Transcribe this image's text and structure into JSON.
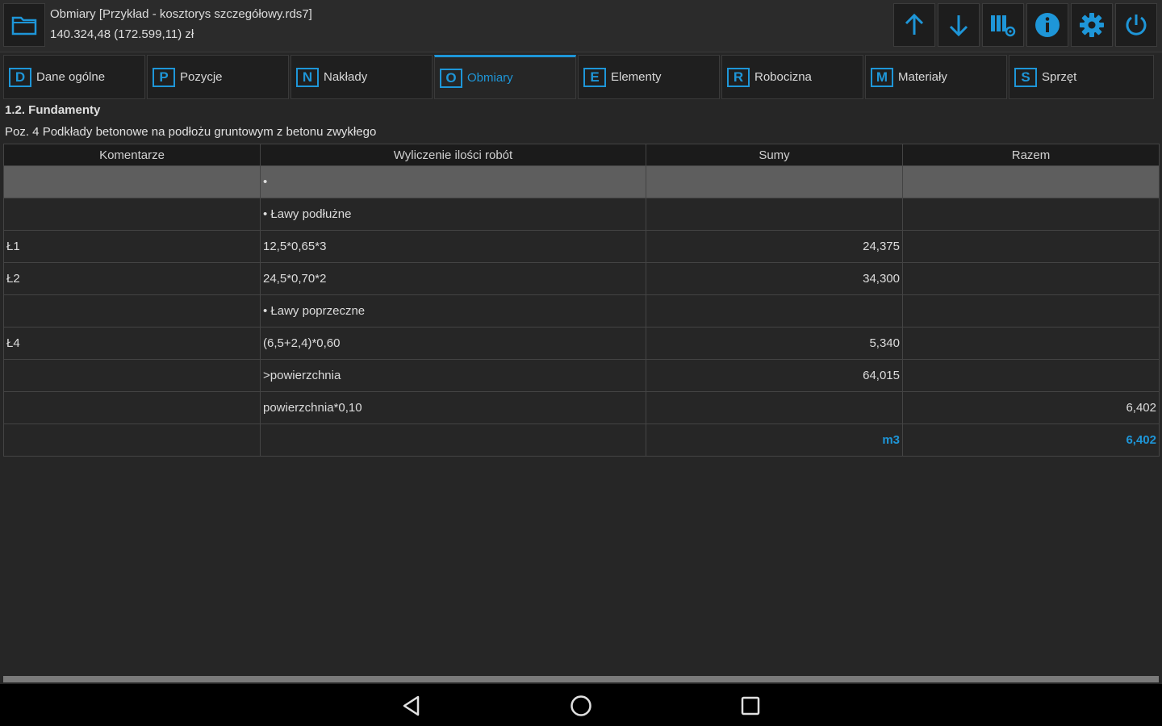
{
  "header": {
    "title": "Obmiary [Przykład - kosztorys szczegółowy.rds7]",
    "subtitle": "140.324,48 (172.599,11) zł",
    "toolbar": [
      {
        "icon": "arrow-up-icon"
      },
      {
        "icon": "arrow-down-icon"
      },
      {
        "icon": "columns-settings-icon"
      },
      {
        "icon": "info-icon"
      },
      {
        "icon": "gear-icon"
      },
      {
        "icon": "power-icon"
      }
    ]
  },
  "tabs": [
    {
      "key": "D",
      "label": "Dane ogólne",
      "active": false
    },
    {
      "key": "P",
      "label": "Pozycje",
      "active": false
    },
    {
      "key": "N",
      "label": "Nakłady",
      "active": false
    },
    {
      "key": "O",
      "label": "Obmiary",
      "active": true
    },
    {
      "key": "E",
      "label": "Elementy",
      "active": false
    },
    {
      "key": "R",
      "label": "Robocizna",
      "active": false
    },
    {
      "key": "M",
      "label": "Materiały",
      "active": false
    },
    {
      "key": "S",
      "label": "Sprzęt",
      "active": false
    }
  ],
  "breadcrumb": {
    "section": "1.2. Fundamenty",
    "position": "Poz. 4 Podkłady betonowe na podłożu gruntowym z betonu zwykłego"
  },
  "table": {
    "columns": [
      "Komentarze",
      "Wyliczenie ilości robót",
      "Sumy",
      "Razem"
    ],
    "rows": [
      [
        "",
        "•",
        "",
        ""
      ],
      [
        "",
        "• Ławy podłużne",
        "",
        ""
      ],
      [
        "Ł1",
        "12,5*0,65*3",
        "24,375",
        ""
      ],
      [
        "Ł2",
        "24,5*0,70*2",
        "34,300",
        ""
      ],
      [
        "",
        "• Ławy poprzeczne",
        "",
        ""
      ],
      [
        "Ł4",
        "(6,5+2,4)*0,60",
        "5,340",
        ""
      ],
      [
        "",
        ">powierzchnia",
        "64,015",
        ""
      ],
      [
        "",
        "powierzchnia*0,10",
        "",
        "6,402"
      ],
      [
        "",
        "",
        "m3",
        "6,402"
      ]
    ]
  },
  "colors": {
    "accent": "#1e96d8",
    "background": "#262626",
    "selected_row": "#5e5e5e"
  }
}
